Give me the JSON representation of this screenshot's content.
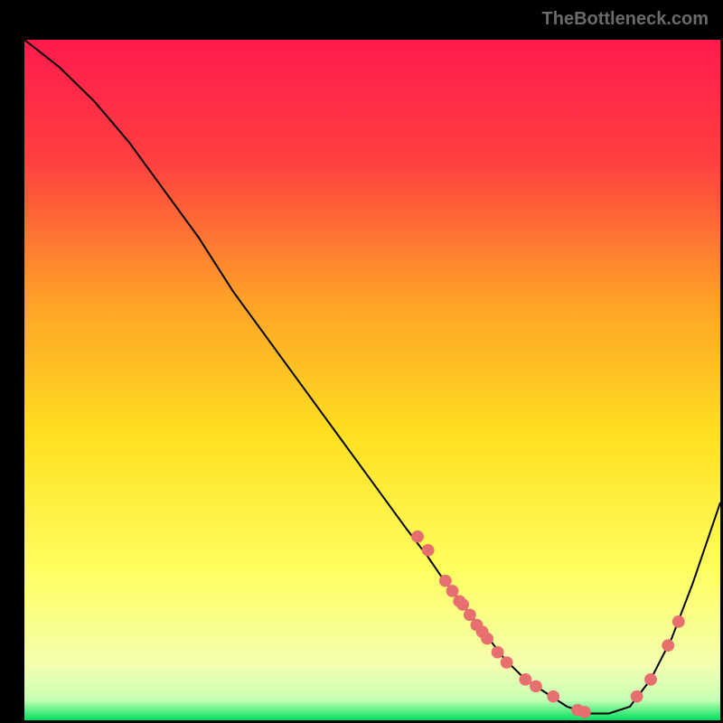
{
  "watermark": "TheBottleneck.com",
  "colors": {
    "bg": "#000000",
    "grad_top": "#ff1a4d",
    "grad_mid1": "#ff6a33",
    "grad_mid2": "#ffd21f",
    "grad_mid3": "#ffff40",
    "grad_low": "#f7ffb0",
    "grad_bottom": "#00e060",
    "curve": "#000000",
    "dot": "#e76f6f"
  },
  "chart_data": {
    "type": "line",
    "title": "",
    "xlabel": "",
    "ylabel": "",
    "xlim": [
      0,
      100
    ],
    "ylim": [
      0,
      100
    ],
    "x": [
      0,
      5,
      10,
      15,
      20,
      25,
      30,
      35,
      40,
      45,
      50,
      55,
      58,
      60,
      63,
      66,
      69,
      72,
      75,
      78,
      81,
      84,
      87,
      90,
      93,
      96,
      100
    ],
    "values": [
      100,
      96,
      91,
      85,
      78,
      71,
      63,
      56,
      49,
      42,
      35,
      28,
      24,
      21,
      17,
      13,
      9,
      6,
      4,
      2,
      1,
      1,
      2,
      6,
      12,
      20,
      32
    ],
    "dots_x": [
      56.5,
      58.0,
      60.5,
      61.5,
      62.5,
      63.0,
      64.0,
      65.0,
      65.8,
      66.5,
      68.0,
      69.3,
      72.0,
      73.5,
      76.0,
      79.5,
      80.5,
      88.0,
      90.0,
      92.5,
      94.0
    ],
    "dots_y": [
      27.0,
      25.0,
      20.5,
      19.0,
      17.5,
      17.0,
      15.5,
      14.0,
      13.0,
      12.0,
      10.0,
      8.5,
      6.0,
      5.0,
      3.5,
      1.5,
      1.2,
      3.5,
      6.0,
      11.0,
      14.5
    ]
  }
}
